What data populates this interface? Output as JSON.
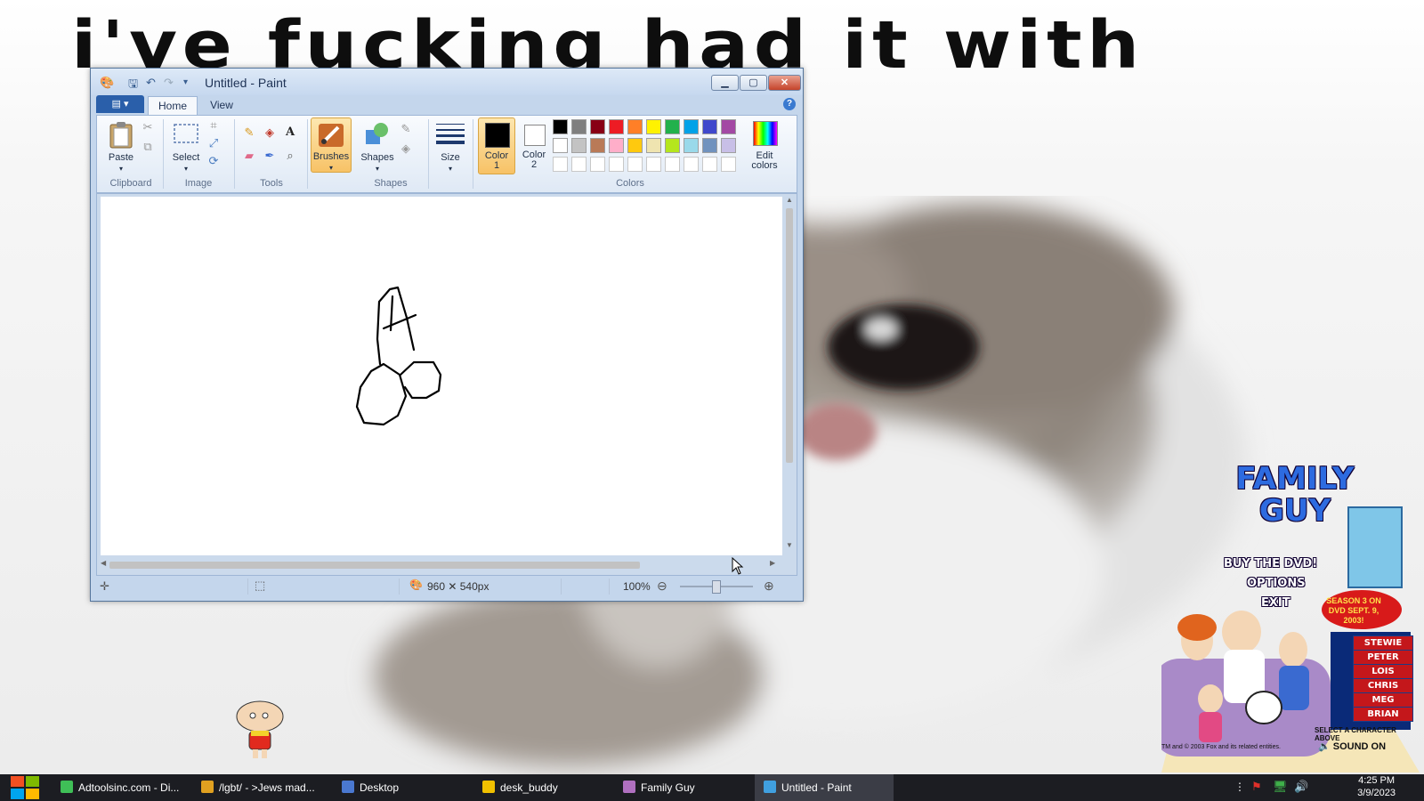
{
  "desktop": {
    "banner_text": "i've fucking had it with",
    "family_guy": {
      "logo": "FAMILY GUY",
      "menu": [
        "BUY THE DVD!",
        "OPTIONS",
        "EXIT"
      ],
      "promo": "SEASON 3 ON DVD SEPT. 9, 2003!",
      "characters": [
        "STEWIE",
        "PETER",
        "LOIS",
        "CHRIS",
        "MEG",
        "BRIAN"
      ],
      "hint": "SELECT A CHARACTER ABOVE",
      "copyright": "TM and © 2003 Fox and its related entities.",
      "sound": "SOUND ON"
    }
  },
  "paint": {
    "title": "Untitled - Paint",
    "tabs": {
      "file": "▤ ▾",
      "home": "Home",
      "view": "View"
    },
    "groups": {
      "clipboard": "Clipboard",
      "image": "Image",
      "tools": "Tools",
      "shapes": "Shapes",
      "colors": "Colors"
    },
    "buttons": {
      "paste": "Paste",
      "select": "Select",
      "brushes": "Brushes",
      "shapes": "Shapes",
      "size": "Size",
      "color1": "Color 1",
      "color2": "Color 2",
      "edit_colors": "Edit colors"
    },
    "palette_row1": [
      "#000000",
      "#7f7f7f",
      "#880015",
      "#ed1c24",
      "#ff7f27",
      "#fff200",
      "#22b14c",
      "#00a2e8",
      "#3f48cc",
      "#a349a4"
    ],
    "palette_row2": [
      "#ffffff",
      "#c3c3c3",
      "#b97a57",
      "#ffaec9",
      "#ffc90e",
      "#efe4b0",
      "#b5e61d",
      "#99d9ea",
      "#7092be",
      "#c8bfe7"
    ],
    "color1": "#000000",
    "color2": "#ffffff",
    "status": {
      "dimensions": "960 ✕ 540px",
      "zoom": "100%"
    }
  },
  "taskbar": {
    "items": [
      {
        "label": "Adtoolsinc.com - Di...",
        "icon_color": "#3fbf57"
      },
      {
        "label": "/lgbt/ - >Jews mad...",
        "icon_color": "#e0a020"
      },
      {
        "label": "Desktop",
        "icon_color": "#4a78d0"
      },
      {
        "label": "desk_buddy",
        "icon_color": "#f0c000"
      },
      {
        "label": "Family Guy",
        "icon_color": "#b070c0"
      },
      {
        "label": "Untitled - Paint",
        "icon_color": "#40a0e0"
      }
    ],
    "time": "4:25 PM",
    "date": "3/9/2023"
  }
}
